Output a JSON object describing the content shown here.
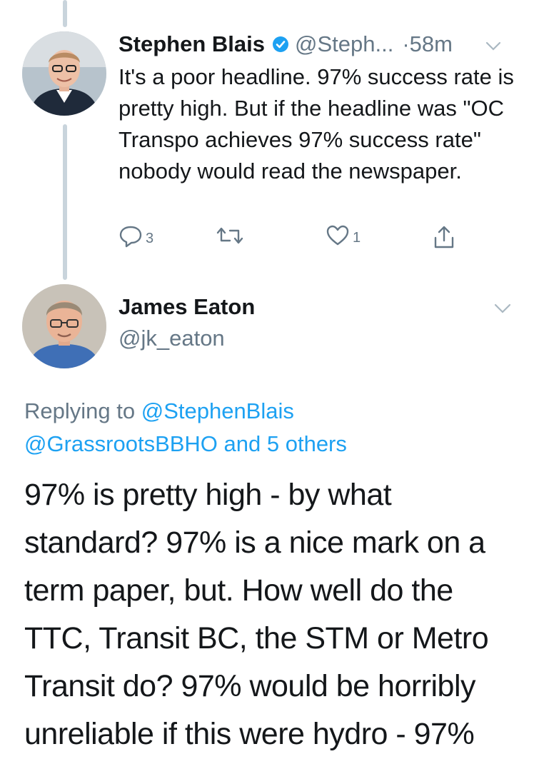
{
  "tweet1": {
    "name": "Stephen Blais",
    "handle": "@Steph...",
    "time": "·58m",
    "text": "It's a poor headline. 97% success rate is pretty high. But if the headline was \"OC Transpo achieves 97% success rate\" nobody would read the newspaper.",
    "reply_count": "3",
    "like_count": "1",
    "icons": {
      "verified": "verified-badge-icon",
      "more": "chevron-down-icon",
      "reply": "reply-icon",
      "retweet": "retweet-icon",
      "like": "heart-icon",
      "share": "share-icon"
    }
  },
  "tweet2": {
    "name": "James Eaton",
    "handle": "@jk_eaton",
    "replying_prefix": "Replying to ",
    "replying_to": "@StephenBlais",
    "replying_rest": "@GrassrootsBBHO and 5 others",
    "text": "97% is pretty high - by what standard?  97% is a nice mark on a term paper, but. How well do the TTC, Transit BC, the STM or Metro Transit do?  97% would be horribly unreliable if this were hydro - 97%"
  },
  "colors": {
    "text": "#14171a",
    "secondary": "#657786",
    "link": "#1da1f2",
    "thread_line": "#c9d4dc"
  }
}
